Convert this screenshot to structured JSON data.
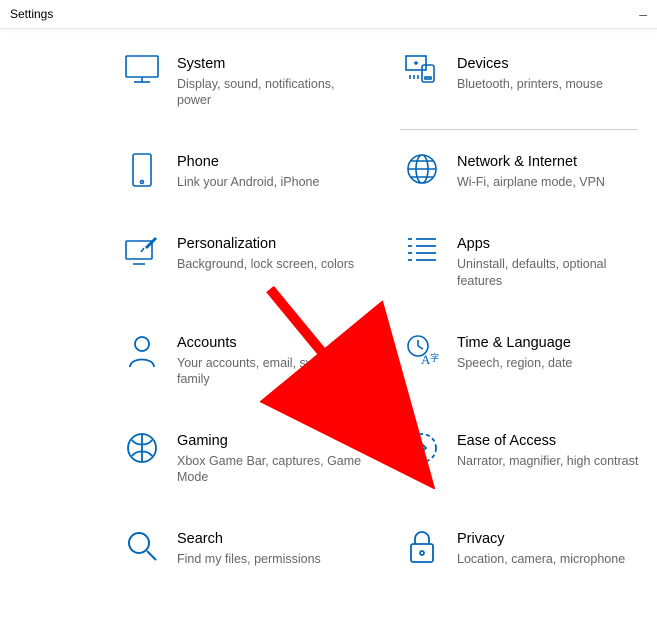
{
  "window": {
    "title": "Settings",
    "minimize": "–"
  },
  "colors": {
    "accent": "#0066b8",
    "subtext": "#666666"
  },
  "tiles": [
    {
      "id": "system",
      "icon": "system-icon",
      "title": "System",
      "sub": "Display, sound, notifications, power"
    },
    {
      "id": "devices",
      "icon": "devices-icon",
      "title": "Devices",
      "sub": "Bluetooth, printers, mouse"
    },
    {
      "id": "phone",
      "icon": "phone-icon",
      "title": "Phone",
      "sub": "Link your Android, iPhone"
    },
    {
      "id": "network",
      "icon": "network-icon",
      "title": "Network & Internet",
      "sub": "Wi-Fi, airplane mode, VPN"
    },
    {
      "id": "personalization",
      "icon": "personalization-icon",
      "title": "Personalization",
      "sub": "Background, lock screen, colors"
    },
    {
      "id": "apps",
      "icon": "apps-icon",
      "title": "Apps",
      "sub": "Uninstall, defaults, optional features"
    },
    {
      "id": "accounts",
      "icon": "accounts-icon",
      "title": "Accounts",
      "sub": "Your accounts, email, sync, work, family"
    },
    {
      "id": "time",
      "icon": "time-icon",
      "title": "Time & Language",
      "sub": "Speech, region, date"
    },
    {
      "id": "gaming",
      "icon": "gaming-icon",
      "title": "Gaming",
      "sub": "Xbox Game Bar, captures, Game Mode"
    },
    {
      "id": "ease",
      "icon": "ease-icon",
      "title": "Ease of Access",
      "sub": "Narrator, magnifier, high contrast"
    },
    {
      "id": "search",
      "icon": "search-icon",
      "title": "Search",
      "sub": "Find my files, permissions"
    },
    {
      "id": "privacy",
      "icon": "privacy-icon",
      "title": "Privacy",
      "sub": "Location, camera, microphone"
    }
  ],
  "annotation": {
    "target": "ease",
    "color": "#ff0000"
  }
}
